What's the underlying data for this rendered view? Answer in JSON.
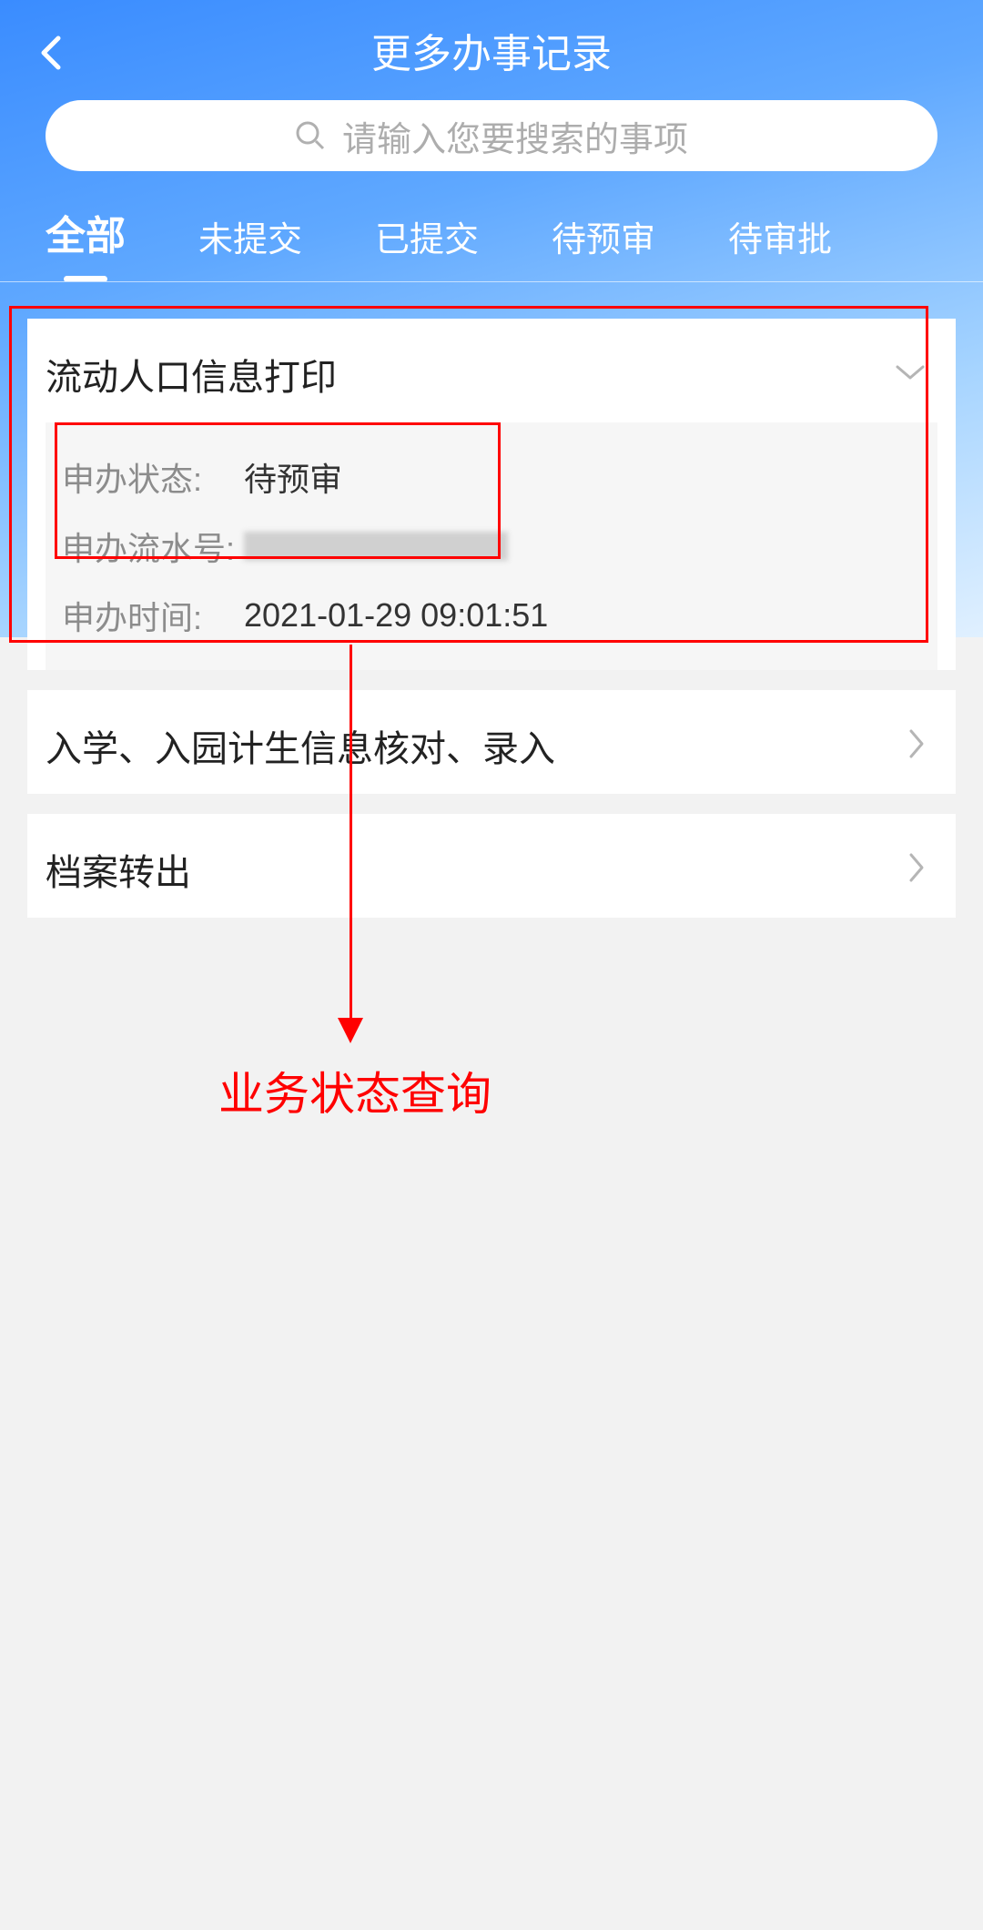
{
  "header": {
    "title": "更多办事记录"
  },
  "search": {
    "placeholder": "请输入您要搜索的事项"
  },
  "tabs": [
    {
      "label": "全部",
      "active": true
    },
    {
      "label": "未提交",
      "active": false
    },
    {
      "label": "已提交",
      "active": false
    },
    {
      "label": "待预审",
      "active": false
    },
    {
      "label": "待审批",
      "active": false
    }
  ],
  "records": [
    {
      "title": "流动人口信息打印",
      "expanded": true,
      "details": {
        "status_label": "申办状态:",
        "status_value": "待预审",
        "serial_label": "申办流水号:",
        "serial_value": "",
        "time_label": "申办时间:",
        "time_value": "2021-01-29 09:01:51"
      }
    },
    {
      "title": "入学、入园计生信息核对、录入",
      "expanded": false
    },
    {
      "title": "档案转出",
      "expanded": false
    }
  ],
  "annotation": {
    "label": "业务状态查询"
  }
}
